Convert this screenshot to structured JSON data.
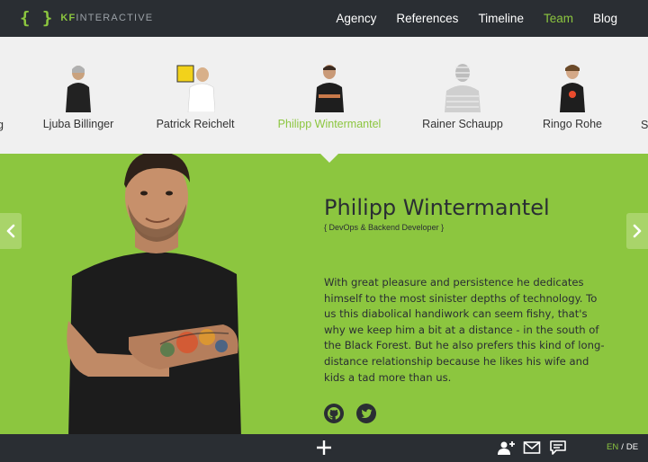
{
  "brand": {
    "braces": "{ }",
    "kf": "KF",
    "rest": "INTERACTIVE"
  },
  "nav": {
    "items": [
      {
        "label": "Agency",
        "active": false
      },
      {
        "label": "References",
        "active": false
      },
      {
        "label": "Timeline",
        "active": false
      },
      {
        "label": "Team",
        "active": true
      },
      {
        "label": "Blog",
        "active": false
      }
    ]
  },
  "team": {
    "edge_left": "g",
    "edge_right": "S",
    "members": [
      {
        "name": "Ljuba Billinger"
      },
      {
        "name": "Patrick Reichelt"
      },
      {
        "name": "Philipp Wintermantel"
      },
      {
        "name": "Rainer Schaupp"
      },
      {
        "name": "Ringo Rohe"
      }
    ]
  },
  "profile": {
    "name": "Philipp Wintermantel",
    "role": "{ DevOps & Backend Developer }",
    "bio": "With great pleasure and persistence he dedicates himself to the most sinister depths of technology. To us this diabolical handiwork can seem fishy, that's why we keep him a bit at a distance - in the south of the Black Forest. But he also prefers this kind of long-distance relationship because he likes his wife and kids a tad more than us."
  },
  "colors": {
    "accent": "#8cc63f",
    "dark": "#2a2e33",
    "strip": "#f0f0f0"
  },
  "icons": [
    "github-icon",
    "twitter-icon",
    "add-user-icon",
    "mail-icon",
    "chat-icon",
    "plus-icon",
    "chevron-left-icon",
    "chevron-right-icon"
  ],
  "lang": {
    "en": "EN",
    "sep": "/",
    "de": "DE"
  }
}
